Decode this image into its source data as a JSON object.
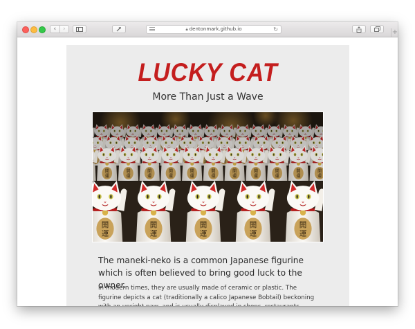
{
  "browser": {
    "url": "dentonmark.github.io",
    "icons": {
      "back": "chevron-left-icon",
      "forward": "chevron-right-icon",
      "sidebar": "sidebar-icon",
      "extension": "hammer-icon",
      "reader": "reader-icon",
      "lock": "lock-icon",
      "reload": "reload-icon",
      "share": "share-icon",
      "tabs": "tabs-icon",
      "new_tab": "plus-icon"
    }
  },
  "page": {
    "title": "Lucky Cat",
    "subtitle": "More Than Just a Wave",
    "lead": "The maneki-neko is a common Japanese figurine which is often believed to bring good luck to the owner.",
    "body": "In modern times, they are usually made of ceramic or plastic. The figurine depicts a cat (traditionally a calico Japanese Bobtail) beckoning with an upright paw, and is usually displayed in shops, restaurants, pachinko parlors, and other"
  },
  "colors": {
    "title_red": "#c41e1e",
    "card_bg": "#ececec"
  }
}
